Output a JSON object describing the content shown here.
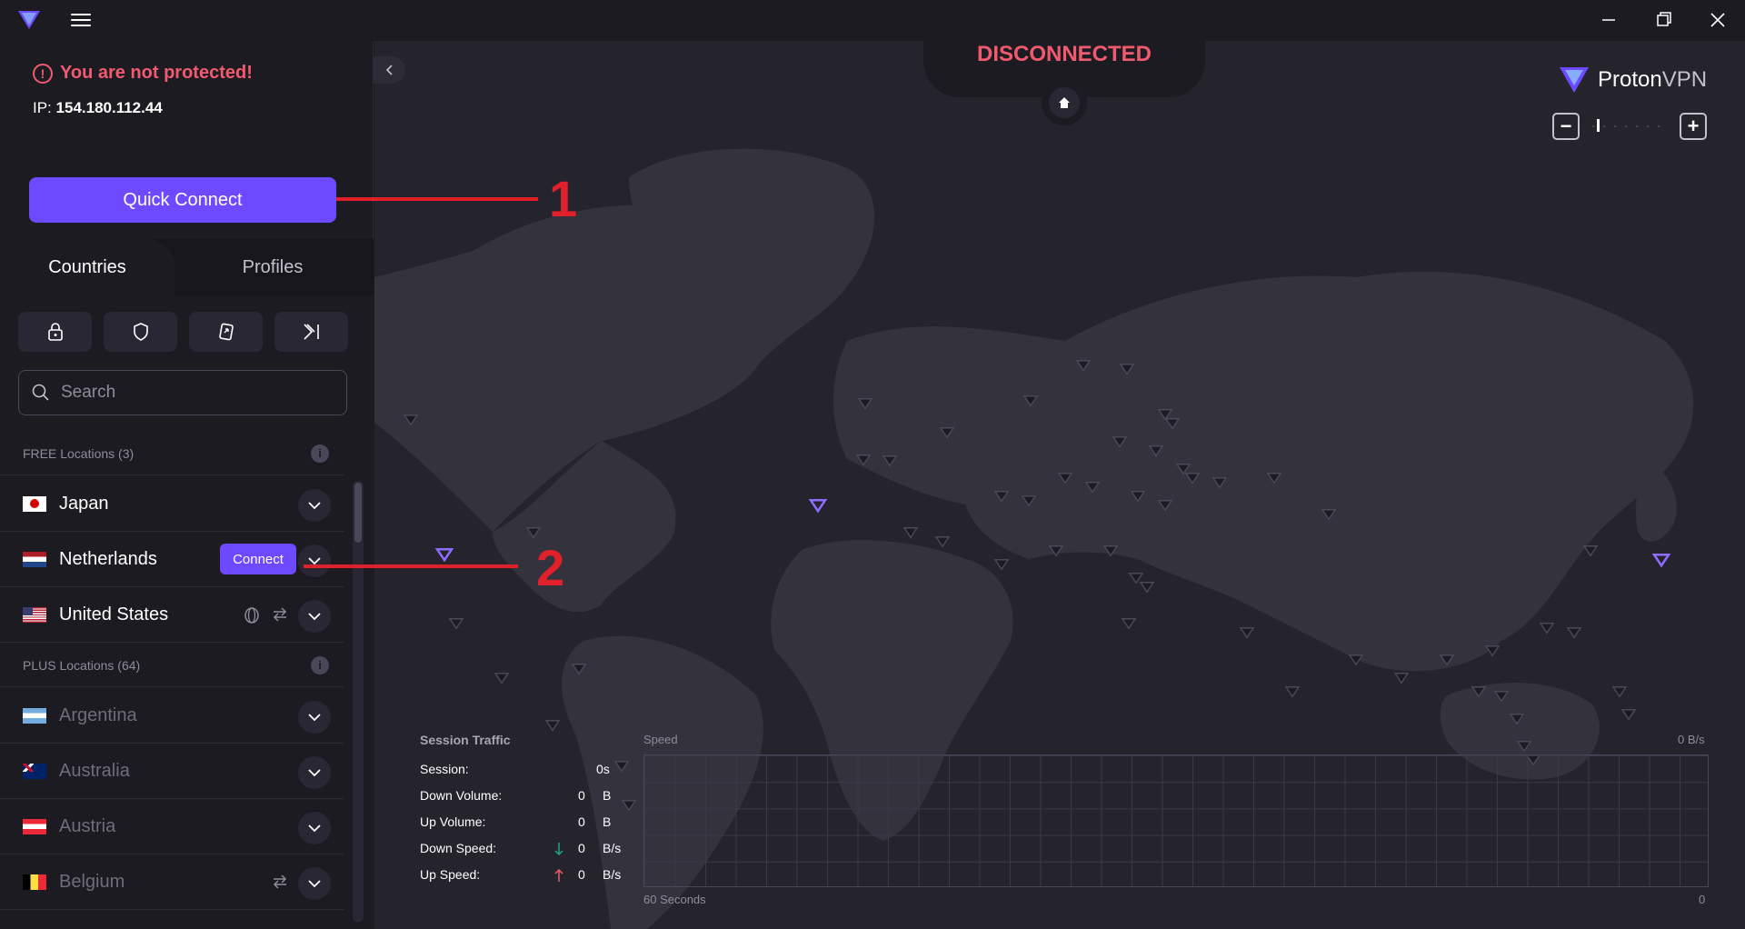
{
  "titlebar": {
    "menu_icon": "hamburger-icon",
    "controls": [
      "minimize-icon",
      "restore-icon",
      "close-icon"
    ]
  },
  "status": {
    "warning": "You are not protected!",
    "ip_label": "IP:",
    "ip_value": "154.180.112.44",
    "connection_state": "DISCONNECTED"
  },
  "quick_connect_label": "Quick Connect",
  "tabs": {
    "countries": "Countries",
    "profiles": "Profiles"
  },
  "filters": [
    "secure-core-lock-icon",
    "netshield-icon",
    "p2p-icon",
    "tor-icon"
  ],
  "search": {
    "placeholder": "Search"
  },
  "free_section": {
    "label": "FREE Locations (3)",
    "countries": [
      {
        "name": "Japan",
        "flag": "jp"
      },
      {
        "name": "Netherlands",
        "flag": "nl",
        "connect_label": "Connect"
      },
      {
        "name": "United States",
        "flag": "us"
      }
    ]
  },
  "plus_section": {
    "label": "PLUS Locations (64)",
    "countries": [
      {
        "name": "Argentina",
        "flag": "ar"
      },
      {
        "name": "Australia",
        "flag": "au"
      },
      {
        "name": "Austria",
        "flag": "at"
      },
      {
        "name": "Belgium",
        "flag": "be"
      }
    ]
  },
  "brand": {
    "proton": "Proton",
    "vpn": "VPN"
  },
  "traffic": {
    "title": "Session Traffic",
    "session_label": "Session:",
    "session_value": "0s",
    "down_volume_label": "Down Volume:",
    "down_volume_value": "0",
    "down_volume_unit": "B",
    "up_volume_label": "Up Volume:",
    "up_volume_value": "0",
    "up_volume_unit": "B",
    "down_speed_label": "Down Speed:",
    "down_speed_value": "0",
    "down_speed_unit": "B/s",
    "up_speed_label": "Up Speed:",
    "up_speed_value": "0",
    "up_speed_unit": "B/s"
  },
  "speed_graph": {
    "label": "Speed",
    "max": "0  B/s",
    "left_label": "60 Seconds",
    "right_label": "0"
  },
  "annotations": {
    "first": "1",
    "second": "2"
  },
  "colors": {
    "accent": "#6d4aff",
    "danger": "#f05a6f",
    "annotation": "#e0202b",
    "background": "#1c1b22"
  }
}
